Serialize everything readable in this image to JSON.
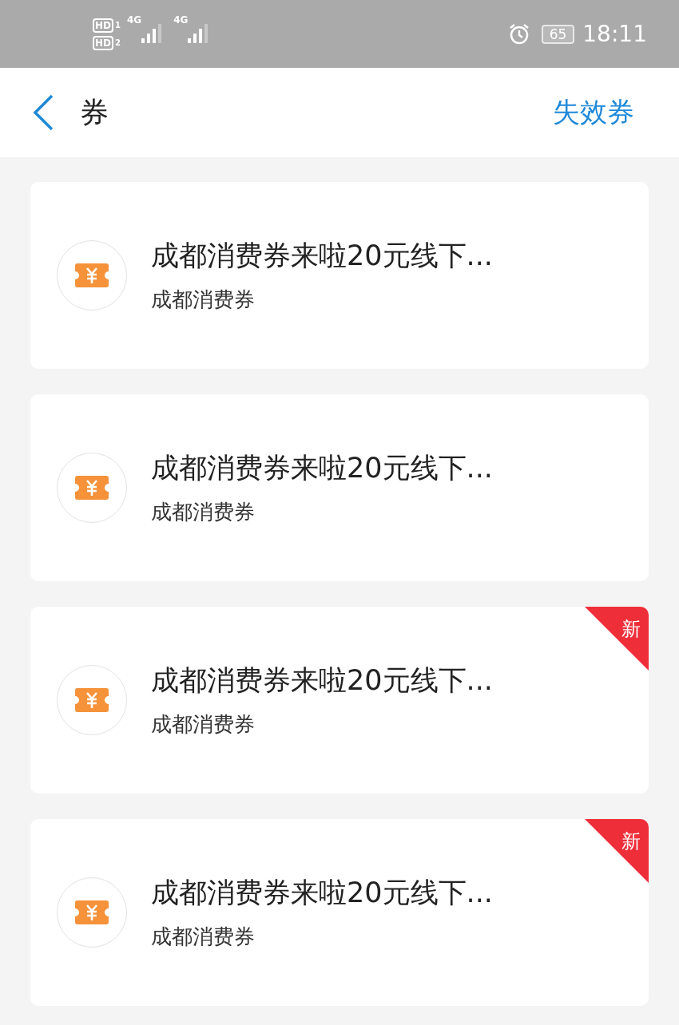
{
  "status_bar": {
    "sims": [
      {
        "hd": "HD",
        "slot": "1",
        "network": "4G"
      },
      {
        "hd": "HD",
        "slot": "2",
        "network": "4G"
      }
    ],
    "battery": "65",
    "time": "18:11"
  },
  "header": {
    "title": "券",
    "action": "失效券"
  },
  "coupons": [
    {
      "title": "成都消费券来啦20元线下...",
      "subtitle": "成都消费券",
      "is_new": false
    },
    {
      "title": "成都消费券来啦20元线下...",
      "subtitle": "成都消费券",
      "is_new": false
    },
    {
      "title": "成都消费券来啦20元线下...",
      "subtitle": "成都消费券",
      "is_new": true,
      "badge": "新"
    },
    {
      "title": "成都消费券来啦20元线下...",
      "subtitle": "成都消费券",
      "is_new": true,
      "badge": "新"
    }
  ]
}
